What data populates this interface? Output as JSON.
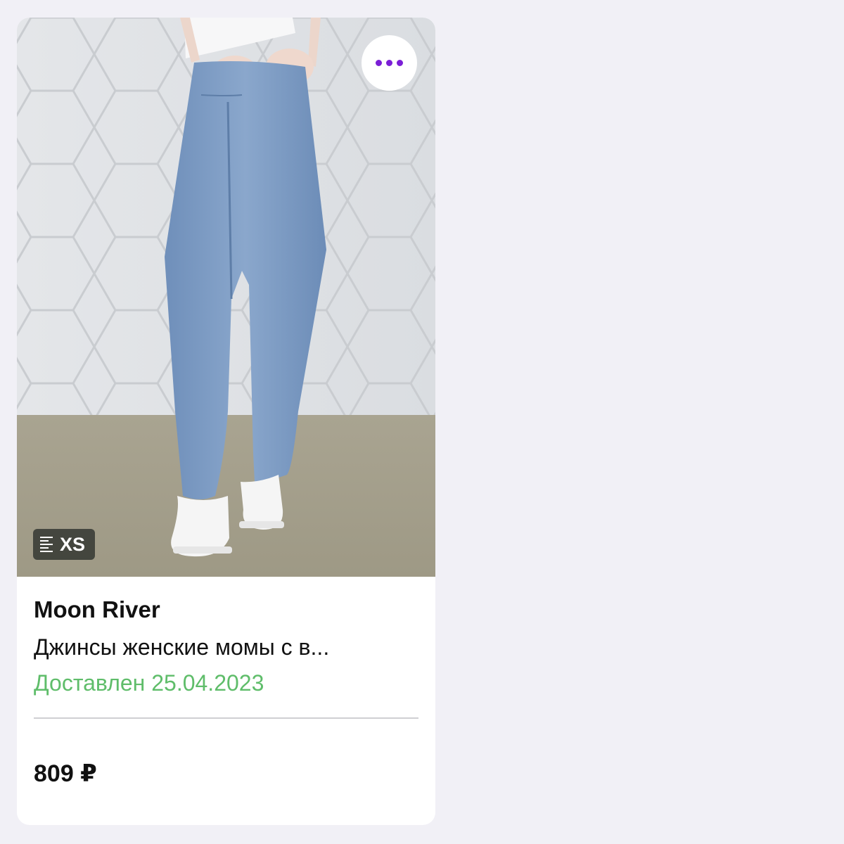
{
  "product": {
    "image_alt": "Джинсы женские момы",
    "more_icon": "more-horizontal-icon",
    "size_icon": "ruler-icon",
    "size_label": "XS",
    "brand": "Moon River",
    "title": "Джинсы женские момы с в...",
    "status": "Доставлен 25.04.2023",
    "price": "809 ₽"
  },
  "colors": {
    "background": "#f1f0f6",
    "card": "#ffffff",
    "accent": "#7b1fd6",
    "status_green": "#5fbd6a",
    "text": "#111111"
  }
}
